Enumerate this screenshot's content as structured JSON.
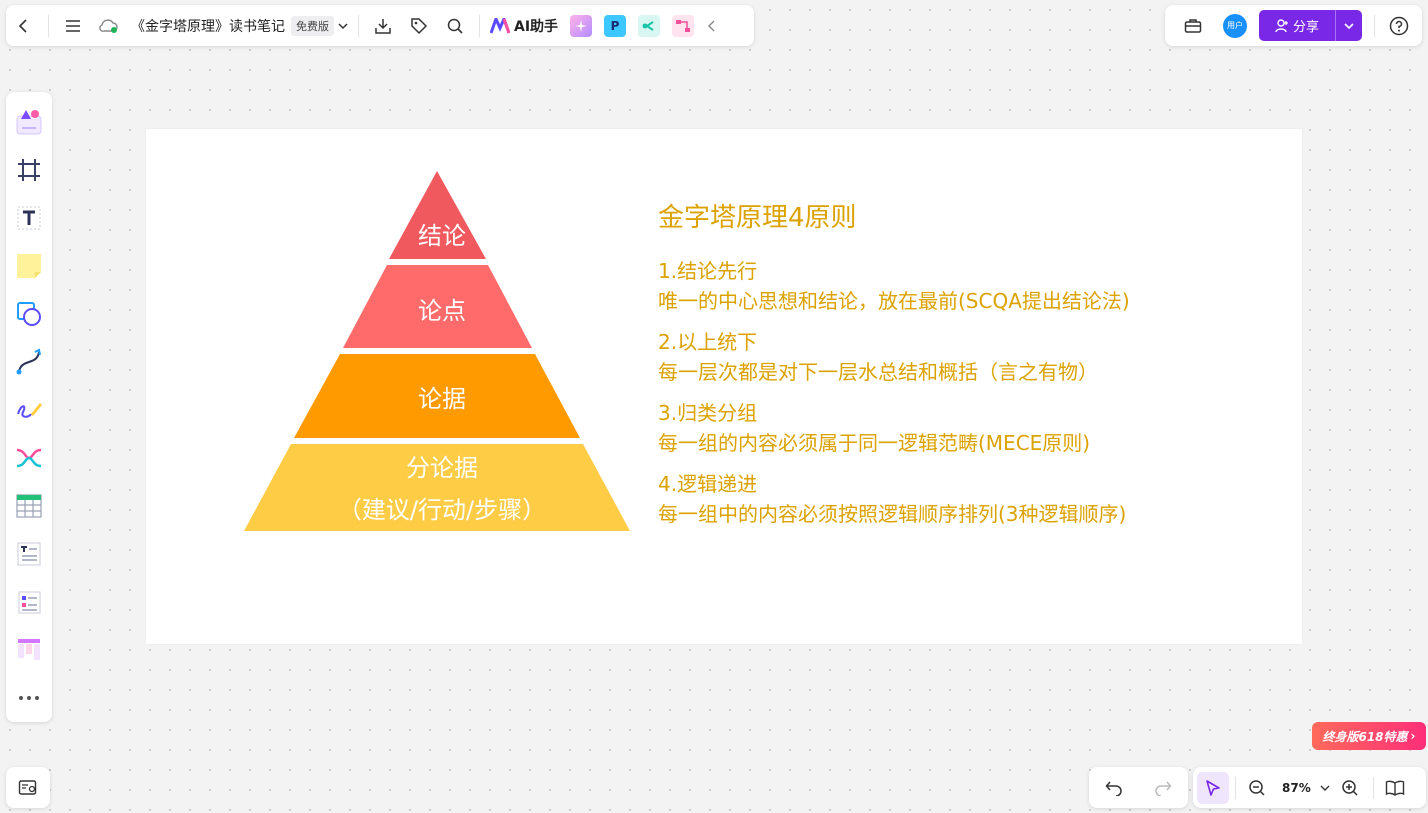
{
  "toolbar": {
    "doc_title": "《金字塔原理》读书笔记",
    "plan_badge": "免费版",
    "ai_label": "AI助手"
  },
  "topright": {
    "avatar_text": "用户",
    "share_label": "分享"
  },
  "zoom": {
    "level": "87%"
  },
  "promo": {
    "text": "终身版618特惠"
  },
  "pyramid": {
    "levels": [
      {
        "label": "结论",
        "color": "#f0595e"
      },
      {
        "label": "论点",
        "color": "#ff6b6b"
      },
      {
        "label": "论据",
        "color": "#ff9a00"
      },
      {
        "label": "分论据",
        "sub": "（建议/行动/步骤）",
        "color": "#ffcc45"
      }
    ]
  },
  "principles": {
    "title": "金字塔原理4原则",
    "items": [
      {
        "head": "1.结论先行",
        "desc": "唯一的中心思想和结论，放在最前(SCQA提出结论法)"
      },
      {
        "head": "2.以上统下",
        "desc": "每一层次都是对下一层水总结和概括（言之有物）"
      },
      {
        "head": "3.归类分组",
        "desc": "每一组的内容必须属于同一逻辑范畴(MECE原则)"
      },
      {
        "head": "4.逻辑递进",
        "desc": "每一组中的内容必须按照逻辑顺序排列(3种逻辑顺序)"
      }
    ],
    "color": "#dca200"
  },
  "colors": {
    "accent": "#7a28e8"
  }
}
